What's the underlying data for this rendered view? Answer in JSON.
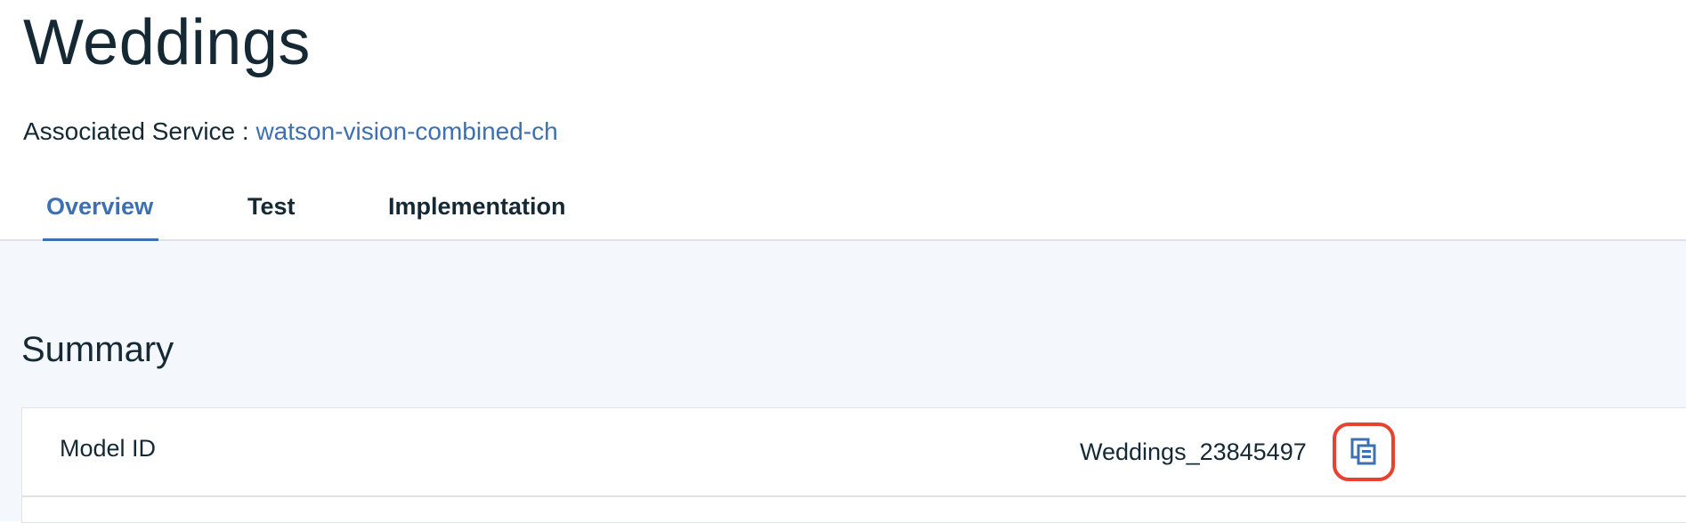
{
  "page": {
    "title": "Weddings"
  },
  "service": {
    "label": "Associated Service :",
    "link_text": "watson-vision-combined-ch"
  },
  "tabs": [
    {
      "label": "Overview",
      "active": true
    },
    {
      "label": "Test",
      "active": false
    },
    {
      "label": "Implementation",
      "active": false
    }
  ],
  "summary": {
    "title": "Summary",
    "rows": [
      {
        "label": "Model ID",
        "value": "Weddings_23845497",
        "action_icon": "copy-icon"
      }
    ]
  },
  "colors": {
    "accent": "#3d70b2",
    "text": "#152935",
    "highlight": "#e8412e",
    "content_background": "#f4f7fb",
    "border": "#dfe3e6"
  }
}
